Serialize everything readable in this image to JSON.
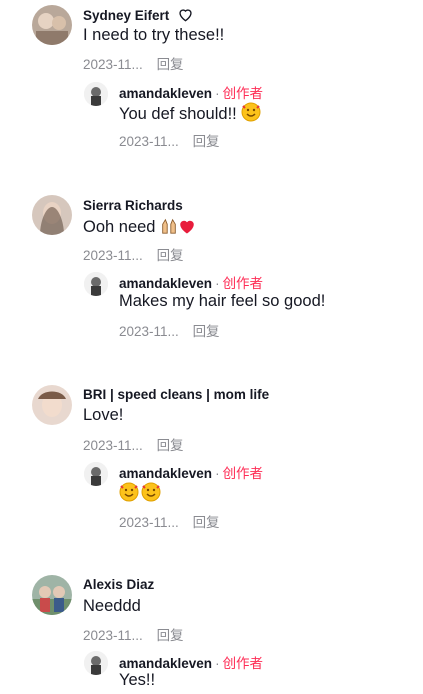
{
  "labels": {
    "creator": "创作者",
    "reply": "回复",
    "separator": "·"
  },
  "comments": [
    {
      "user": "Sydney Eifert",
      "text": "I need to try these!!",
      "date": "2023-11...",
      "reply": {
        "user": "amandakleven",
        "text": "You def should!!",
        "date": "2023-11..."
      }
    },
    {
      "user": "Sierra Richards",
      "text": "Ooh need",
      "date": "2023-11...",
      "reply": {
        "user": "amandakleven",
        "text": "Makes my hair feel so good!",
        "date": "2023-11..."
      }
    },
    {
      "user": "BRI | speed cleans | mom life",
      "text": "Love!",
      "date": "2023-11...",
      "reply": {
        "user": "amandakleven",
        "text": "",
        "date": "2023-11..."
      }
    },
    {
      "user": "Alexis Diaz",
      "text": "Needdd",
      "date": "2023-11...",
      "reply": {
        "user": "amandakleven",
        "text": "Yes!!",
        "date": ""
      }
    }
  ],
  "colors": {
    "creator": "#fe2c55",
    "meta": "#8a8b91",
    "text": "#161823"
  },
  "icons": [
    "heart-outline-icon",
    "smiling-face-with-hearts-emoji",
    "raising-hands-emoji",
    "red-heart-emoji"
  ]
}
